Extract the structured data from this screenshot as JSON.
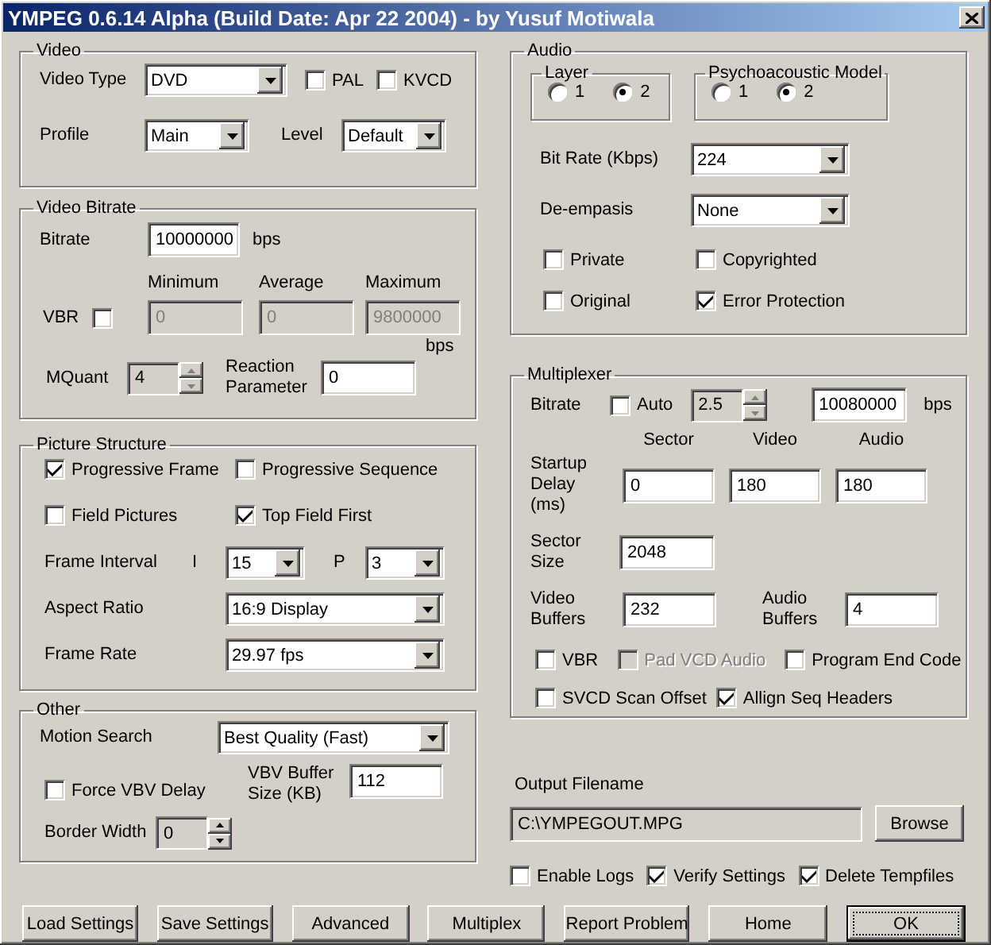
{
  "window": {
    "title": "YMPEG 0.6.14 Alpha (Build Date: Apr 22 2004) - by Yusuf Motiwala"
  },
  "video": {
    "title": "Video",
    "video_type": {
      "label": "Video Type",
      "value": "DVD"
    },
    "options": [
      {
        "label": "PAL",
        "checked": false
      },
      {
        "label": "KVCD",
        "checked": false
      }
    ],
    "profile": {
      "label": "Profile",
      "value": "Main"
    },
    "level": {
      "label": "Level",
      "value": "Default"
    }
  },
  "video_bitrate": {
    "title": "Video Bitrate",
    "bitrate": {
      "label": "Bitrate",
      "value": "10000000",
      "unit": "bps"
    },
    "vbr": {
      "label": "VBR",
      "checked": false
    },
    "vbr_fields": [
      {
        "label": "Minimum",
        "value": "0",
        "disabled": true
      },
      {
        "label": "Average",
        "value": "0",
        "disabled": true
      },
      {
        "label": "Maximum",
        "value": "9800000",
        "disabled": true
      }
    ],
    "vbr_unit": "bps",
    "mquant": {
      "label": "MQuant",
      "value": "4",
      "disabled": true
    },
    "reaction": {
      "label": "Reaction Parameter",
      "value": "0"
    }
  },
  "picture_structure": {
    "title": "Picture Structure",
    "checks": [
      {
        "label": "Progressive Frame",
        "checked": true
      },
      {
        "label": "Progressive Sequence",
        "checked": false
      },
      {
        "label": "Field Pictures",
        "checked": false
      },
      {
        "label": "Top Field First",
        "checked": true
      }
    ],
    "frame_interval": {
      "label": "Frame Interval",
      "i_label": "I",
      "i_value": "15",
      "p_label": "P",
      "p_value": "3"
    },
    "aspect_ratio": {
      "label": "Aspect Ratio",
      "value": "16:9 Display"
    },
    "frame_rate": {
      "label": "Frame Rate",
      "value": "29.97 fps"
    }
  },
  "other": {
    "title": "Other",
    "motion_search": {
      "label": "Motion Search",
      "value": "Best Quality (Fast)"
    },
    "force_vbv": {
      "label": "Force VBV Delay",
      "checked": false
    },
    "vbv_buffer": {
      "label": "VBV Buffer Size (KB)",
      "value": "112"
    },
    "border_width": {
      "label": "Border Width",
      "value": "0",
      "disabled": false
    }
  },
  "audio": {
    "title": "Audio",
    "layer": {
      "title": "Layer",
      "options": [
        {
          "label": "1",
          "selected": false
        },
        {
          "label": "2",
          "selected": true
        }
      ]
    },
    "psy_model": {
      "title": "Psychoacoustic Model",
      "options": [
        {
          "label": "1",
          "selected": false
        },
        {
          "label": "2",
          "selected": true
        }
      ]
    },
    "bit_rate": {
      "label": "Bit Rate (Kbps)",
      "value": "224"
    },
    "de_emphasis": {
      "label": "De-empasis",
      "value": "None"
    },
    "checks": [
      {
        "label": "Private",
        "checked": false
      },
      {
        "label": "Copyrighted",
        "checked": false
      },
      {
        "label": "Original",
        "checked": false
      },
      {
        "label": "Error Protection",
        "checked": true
      }
    ]
  },
  "multiplexer": {
    "title": "Multiplexer",
    "bitrate_label": "Bitrate",
    "auto": {
      "label": "Auto",
      "checked": false
    },
    "auto_value": {
      "value": "2.5",
      "disabled": true
    },
    "bitrate": {
      "value": "10080000",
      "unit": "bps"
    },
    "startup_delay": {
      "label": "Startup Delay (ms)",
      "fields": [
        {
          "label": "Sector",
          "value": "0"
        },
        {
          "label": "Video",
          "value": "180"
        },
        {
          "label": "Audio",
          "value": "180"
        }
      ]
    },
    "sector_size": {
      "label": "Sector Size",
      "value": "2048"
    },
    "video_buffers": {
      "label": "Video Buffers",
      "value": "232"
    },
    "audio_buffers": {
      "label": "Audio Buffers",
      "value": "4"
    },
    "checks": [
      {
        "label": "VBR",
        "checked": false,
        "disabled": false
      },
      {
        "label": "Pad VCD Audio",
        "checked": false,
        "disabled": true
      },
      {
        "label": "Program End Code",
        "checked": false,
        "disabled": false
      },
      {
        "label": "SVCD Scan Offset",
        "checked": false,
        "disabled": false
      },
      {
        "label": "Allign Seq Headers",
        "checked": true,
        "disabled": false
      }
    ]
  },
  "output": {
    "label": "Output Filename",
    "value": "C:\\YMPEGOUT.MPG",
    "read_only": true,
    "button": "Browse"
  },
  "flags": [
    {
      "label": "Enable Logs",
      "checked": false
    },
    {
      "label": "Verify Settings",
      "checked": true
    },
    {
      "label": "Delete Tempfiles",
      "checked": true
    }
  ],
  "buttons": [
    {
      "label": "Load Settings",
      "default": false
    },
    {
      "label": "Save Settings",
      "default": false
    },
    {
      "label": "Advanced",
      "default": false
    },
    {
      "label": "Multiplex",
      "default": false
    },
    {
      "label": "Report Problem",
      "default": false
    },
    {
      "label": "Home",
      "default": false
    },
    {
      "label": "OK",
      "default": true
    }
  ]
}
